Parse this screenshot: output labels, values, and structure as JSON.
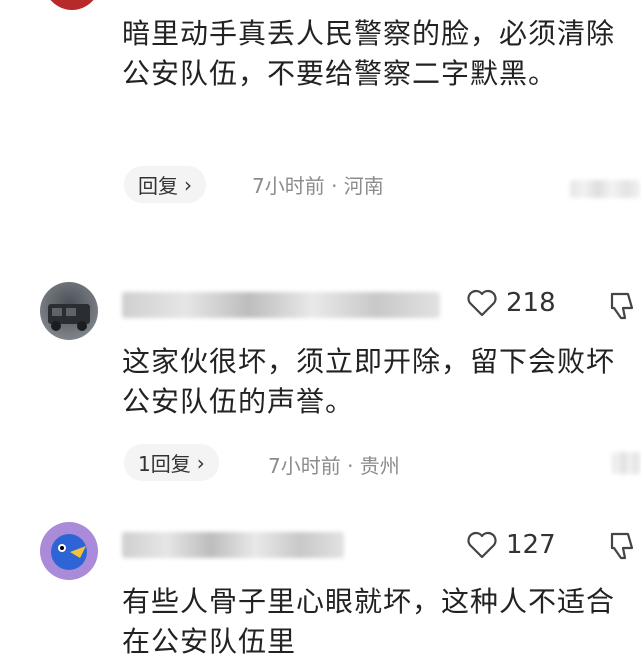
{
  "comments": [
    {
      "text": "暗里动手真丢人民警察的脸，必须清除公安队伍，不要给警察二字默黑。",
      "reply_label": "回复",
      "time_location": "7小时前 · 河南"
    },
    {
      "likes": "218",
      "text": "这家伙很坏，须立即开除，留下会败坏公安队伍的声誉。",
      "reply_label": "1回复",
      "time_location": "7小时前 · 贵州"
    },
    {
      "likes": "127",
      "text": "有些人骨子里心眼就坏，这种人不适合在公安队伍里"
    }
  ],
  "icons": {
    "chevron": "chevron-right-icon",
    "like": "heart-icon",
    "dislike": "thumbs-down-icon"
  }
}
